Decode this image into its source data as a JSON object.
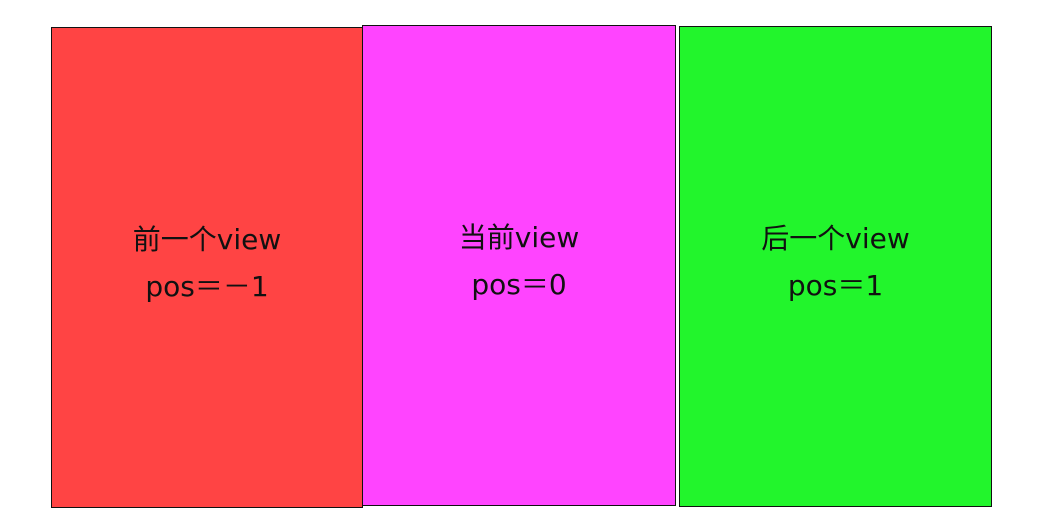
{
  "panels": [
    {
      "id": "prev",
      "title": "前一个view",
      "pos": "pos＝－1",
      "color": "#ff4444"
    },
    {
      "id": "current",
      "title": "当前view",
      "pos": "pos＝0",
      "color": "#ff44ff"
    },
    {
      "id": "next",
      "title": "后一个view",
      "pos": "pos＝1",
      "color": "#22f52c"
    }
  ]
}
